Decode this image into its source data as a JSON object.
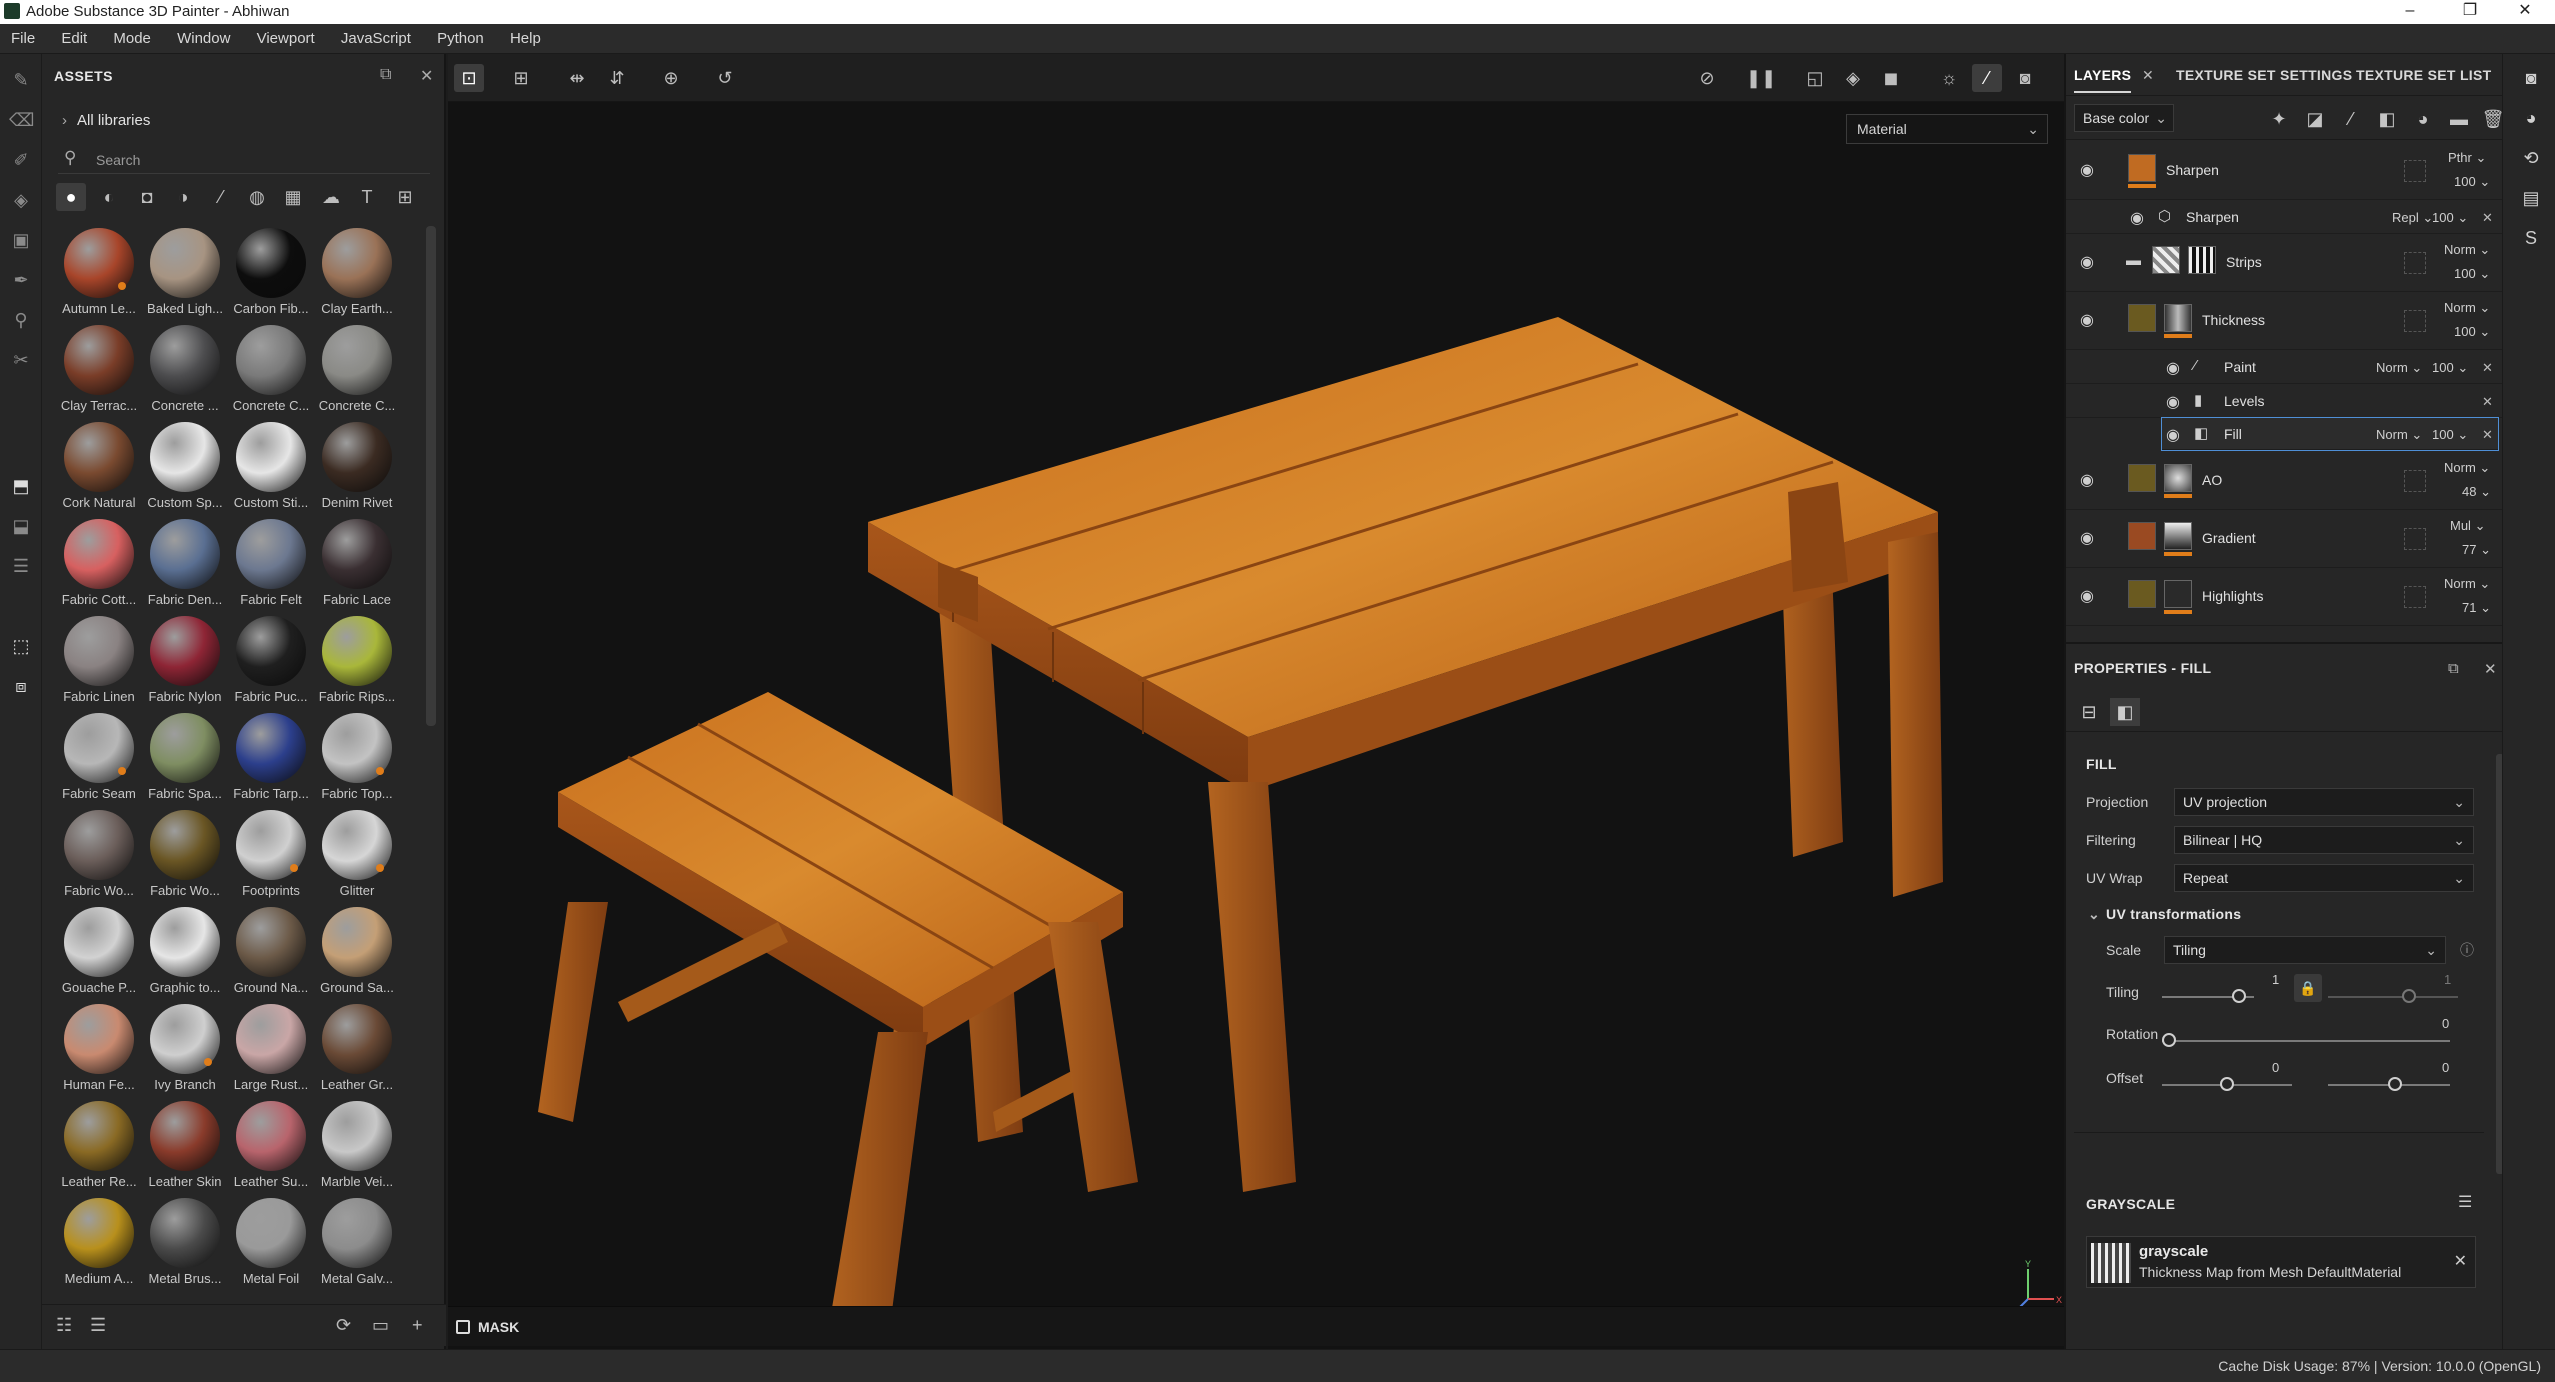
{
  "window": {
    "title": "Adobe Substance 3D Painter - Abhiwan",
    "controls": [
      "–",
      "❐",
      "✕"
    ]
  },
  "menu": [
    "File",
    "Edit",
    "Mode",
    "Window",
    "Viewport",
    "JavaScript",
    "Python",
    "Help"
  ],
  "assets": {
    "title": "ASSETS",
    "library": "All libraries",
    "search_placeholder": "Search",
    "items": [
      {
        "label": "Autumn Le...",
        "color": "#a8452a",
        "badge": true
      },
      {
        "label": "Baked Ligh...",
        "color": "#a79482",
        "badge": false
      },
      {
        "label": "Carbon Fib...",
        "color": "#0d0d0d",
        "badge": false
      },
      {
        "label": "Clay Earth...",
        "color": "#9a7257",
        "badge": false
      },
      {
        "label": "Clay Terrac...",
        "color": "#7a3d28",
        "badge": false
      },
      {
        "label": "Concrete ...",
        "color": "#4d4d4f",
        "badge": false
      },
      {
        "label": "Concrete C...",
        "color": "#7a7a7a",
        "badge": false
      },
      {
        "label": "Concrete C...",
        "color": "#8a8a86",
        "badge": false
      },
      {
        "label": "Cork Natural",
        "color": "#7a4a30",
        "badge": false
      },
      {
        "label": "Custom Sp...",
        "color": "#e6e6e6",
        "badge": false
      },
      {
        "label": "Custom Sti...",
        "color": "#e6e6e6",
        "badge": false
      },
      {
        "label": "Denim Rivet",
        "color": "#3b2b22",
        "badge": false
      },
      {
        "label": "Fabric Cott...",
        "color": "#d76060",
        "badge": false
      },
      {
        "label": "Fabric Den...",
        "color": "#5a6f92",
        "badge": false
      },
      {
        "label": "Fabric Felt",
        "color": "#6c7890",
        "badge": false
      },
      {
        "label": "Fabric Lace",
        "color": "#3a2f32",
        "badge": false
      },
      {
        "label": "Fabric Linen",
        "color": "#8a8282",
        "badge": false
      },
      {
        "label": "Fabric Nylon",
        "color": "#8e2535",
        "badge": false
      },
      {
        "label": "Fabric Puc...",
        "color": "#1f1f1f",
        "badge": false
      },
      {
        "label": "Fabric Rips...",
        "color": "#a9b73a",
        "badge": false
      },
      {
        "label": "Fabric Seam",
        "color": "#b7b7b7",
        "badge": true
      },
      {
        "label": "Fabric Spa...",
        "color": "#7f8e62",
        "badge": false
      },
      {
        "label": "Fabric Tarp...",
        "color": "#2c3f8c",
        "badge": false
      },
      {
        "label": "Fabric Top...",
        "color": "#c3c3c3",
        "badge": true
      },
      {
        "label": "Fabric Wo...",
        "color": "#6b5e5a",
        "badge": false
      },
      {
        "label": "Fabric Wo...",
        "color": "#6a5624",
        "badge": false
      },
      {
        "label": "Footprints",
        "color": "#d0d0d0",
        "badge": true
      },
      {
        "label": "Glitter",
        "color": "#d6d6d6",
        "badge": true
      },
      {
        "label": "Gouache P...",
        "color": "#d2d2d2",
        "badge": false
      },
      {
        "label": "Graphic to...",
        "color": "#e6e6e6",
        "badge": false
      },
      {
        "label": "Ground Na...",
        "color": "#6c5a48",
        "badge": false
      },
      {
        "label": "Ground Sa...",
        "color": "#c49f76",
        "badge": false
      },
      {
        "label": "Human Fe...",
        "color": "#c98a70",
        "badge": false
      },
      {
        "label": "Ivy Branch",
        "color": "#cfcfcf",
        "badge": true
      },
      {
        "label": "Large Rust...",
        "color": "#c9a6a6",
        "badge": false
      },
      {
        "label": "Leather Gr...",
        "color": "#6a4a36",
        "badge": false
      },
      {
        "label": "Leather Re...",
        "color": "#8a6a24",
        "badge": false
      },
      {
        "label": "Leather Skin",
        "color": "#8a3b2b",
        "badge": false
      },
      {
        "label": "Leather Su...",
        "color": "#b8646c",
        "badge": false
      },
      {
        "label": "Marble Vei...",
        "color": "#c8c8c8",
        "badge": false
      },
      {
        "label": "Medium A...",
        "color": "#b8901c",
        "badge": false
      },
      {
        "label": "Metal Brus...",
        "color": "#4a4a4a",
        "badge": false
      },
      {
        "label": "Metal Foil",
        "color": "#9a9a9a",
        "badge": false
      },
      {
        "label": "Metal Galv...",
        "color": "#8c8c8c",
        "badge": false
      }
    ]
  },
  "viewport": {
    "material_select": "Material",
    "mask_label": "MASK",
    "gizmo": {
      "y": "Y",
      "x": "X",
      "z": "Z"
    }
  },
  "right": {
    "tabs": [
      "LAYERS",
      "TEXTURE SET SETTINGS",
      "TEXTURE SET LIST"
    ],
    "channel": "Base color",
    "layers": [
      {
        "name": "Sharpen",
        "blend": "Pthr",
        "opacity": "100"
      },
      {
        "name": "Sharpen",
        "blend": "Repl",
        "opacity": "100",
        "sub": true
      },
      {
        "name": "Strips",
        "blend": "Norm",
        "opacity": "100"
      },
      {
        "name": "Thickness",
        "blend": "Norm",
        "opacity": "100"
      },
      {
        "name": "Paint",
        "blend": "Norm",
        "opacity": "100",
        "sub": true
      },
      {
        "name": "Levels",
        "sub": true
      },
      {
        "name": "Fill",
        "blend": "Norm",
        "opacity": "100",
        "sub": true,
        "selected": true
      },
      {
        "name": "AO",
        "blend": "Norm",
        "opacity": "48"
      },
      {
        "name": "Gradient",
        "blend": "Mul",
        "opacity": "77"
      },
      {
        "name": "Highlights",
        "blend": "Norm",
        "opacity": "71"
      }
    ],
    "properties": {
      "title": "PROPERTIES - FILL",
      "section": "FILL",
      "projection_label": "Projection",
      "projection": "UV projection",
      "filtering_label": "Filtering",
      "filtering": "Bilinear | HQ",
      "uvwrap_label": "UV Wrap",
      "uvwrap": "Repeat",
      "uvt_label": "UV transformations",
      "scale_label": "Scale",
      "scale": "Tiling",
      "tiling_label": "Tiling",
      "tiling_value": "1",
      "tiling_value2": "1",
      "rotation_label": "Rotation",
      "rotation_value": "0",
      "offset_label": "Offset",
      "offset_u": "0",
      "offset_v": "0",
      "grayscale_section": "GRAYSCALE",
      "grayscale_name": "grayscale",
      "grayscale_desc": "Thickness Map from Mesh DefaultMaterial"
    }
  },
  "status": {
    "text": "Cache Disk Usage:   87% | Version: 10.0.0 (OpenGL)"
  }
}
